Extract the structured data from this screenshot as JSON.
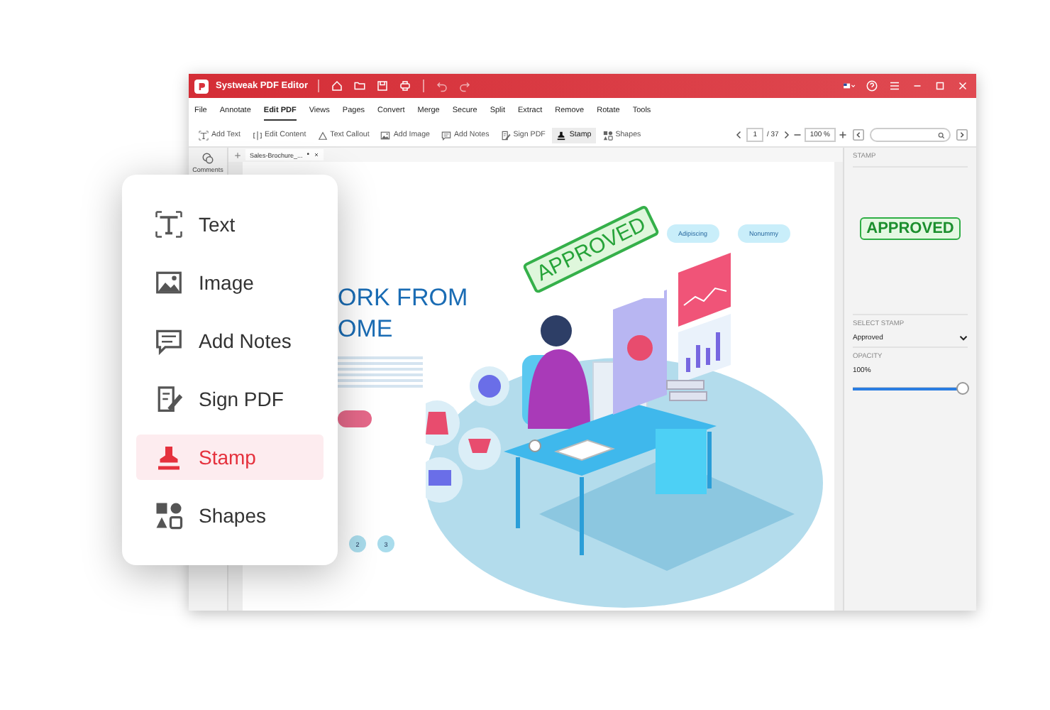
{
  "window": {
    "title": "Systweak PDF Editor"
  },
  "menu": [
    {
      "label": "File",
      "selected": false
    },
    {
      "label": "Annotate",
      "selected": false
    },
    {
      "label": "Edit PDF",
      "selected": true
    },
    {
      "label": "Views",
      "selected": false
    },
    {
      "label": "Pages",
      "selected": false
    },
    {
      "label": "Convert",
      "selected": false
    },
    {
      "label": "Merge",
      "selected": false
    },
    {
      "label": "Secure",
      "selected": false
    },
    {
      "label": "Split",
      "selected": false
    },
    {
      "label": "Extract",
      "selected": false
    },
    {
      "label": "Remove",
      "selected": false
    },
    {
      "label": "Rotate",
      "selected": false
    },
    {
      "label": "Tools",
      "selected": false
    }
  ],
  "toolbar": [
    {
      "label": "Add Text",
      "kind": "text",
      "selected": false
    },
    {
      "label": "Edit Content",
      "kind": "edit",
      "selected": false
    },
    {
      "label": "Text Callout",
      "kind": "callout",
      "selected": false
    },
    {
      "label": "Add Image",
      "kind": "image",
      "selected": false
    },
    {
      "label": "Add Notes",
      "kind": "notes",
      "selected": false
    },
    {
      "label": "Sign PDF",
      "kind": "sign",
      "selected": false
    },
    {
      "label": "Stamp",
      "kind": "stamp",
      "selected": true
    },
    {
      "label": "Shapes",
      "kind": "shapes",
      "selected": false
    }
  ],
  "page_nav": {
    "current": "1",
    "total": "/ 37",
    "zoom": "100 %"
  },
  "side_rail": {
    "label": "Comments"
  },
  "document_tab": {
    "label": "Sales-Brochure_...",
    "modified": "•"
  },
  "document": {
    "headline": [
      "ORK FROM",
      "OME"
    ],
    "tags": [
      "Adipiscing",
      "Nonummy"
    ],
    "stamp": "APPROVED",
    "pages": [
      "2",
      "3"
    ]
  },
  "right_panel": {
    "title": "STAMP",
    "preview": "APPROVED",
    "select_label": "SELECT STAMP",
    "select_value": "Approved",
    "opacity": {
      "label": "OPACITY",
      "value": "100%",
      "level": 1.0
    }
  },
  "tools_card": [
    {
      "label": "Text",
      "kind": "text",
      "selected": false
    },
    {
      "label": "Image",
      "kind": "image",
      "selected": false
    },
    {
      "label": "Add Notes",
      "kind": "notes",
      "selected": false
    },
    {
      "label": "Sign PDF",
      "kind": "sign",
      "selected": false
    },
    {
      "label": "Stamp",
      "kind": "stamp",
      "selected": true
    },
    {
      "label": "Shapes",
      "kind": "shapes",
      "selected": false
    }
  ]
}
